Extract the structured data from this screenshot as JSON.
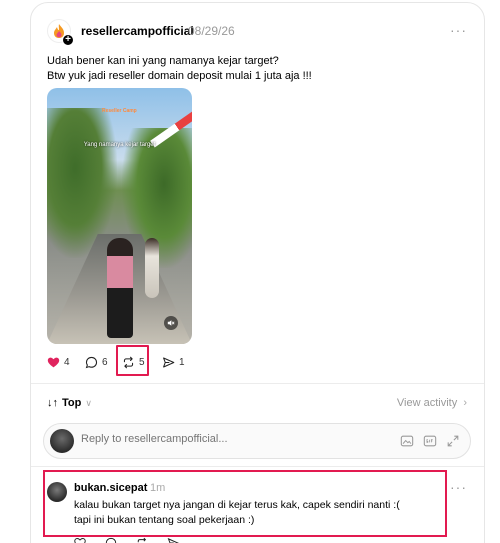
{
  "post": {
    "username": "resellercampofficial",
    "date": "08/29/26",
    "more": "···",
    "text_line1": "Udah bener kan ini yang namanya kejar target?",
    "text_line2": "Btw yuk jadi reseller domain deposit mulai 1 juta aja !!!",
    "video": {
      "overlay_text": "Yang namanya kejar target",
      "brand_tag": "Reseller Camp"
    },
    "actions": {
      "like_count": "4",
      "reply_count": "6",
      "repost_count": "5",
      "share_count": "1"
    }
  },
  "thread": {
    "sort_label": "Top",
    "view_activity": "View activity",
    "reply_placeholder": "Reply to resellercampofficial..."
  },
  "comment": {
    "username": "bukan.sicepat",
    "time": "1m",
    "more": "···",
    "line1": "kalau bukan target nya jangan di kejar terus kak, capek sendiri nanti :(",
    "line2": "tapi ini bukan tentang soal pekerjaan :)"
  },
  "colors": {
    "like": "#e0245e",
    "highlight_box": "#e21a50"
  },
  "icons": [
    "heart-icon",
    "comment-icon",
    "repost-icon",
    "share-icon",
    "mute-icon",
    "image-icon",
    "gif-icon",
    "expand-icon"
  ]
}
